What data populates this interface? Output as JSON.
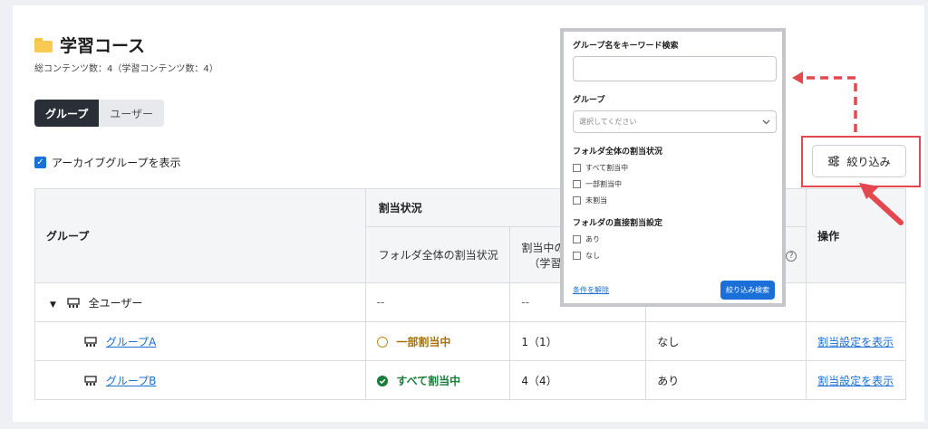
{
  "header": {
    "title": "学習コース",
    "summary": "総コンテンツ数：4（学習コンテンツ数：4）"
  },
  "tabs": [
    {
      "label": "グループ",
      "active": true
    },
    {
      "label": "ユーザー",
      "active": false
    }
  ],
  "archive_toggle": {
    "label": "アーカイブグループを表示",
    "checked": true
  },
  "filter_button": {
    "label": "絞り込み",
    "icon": "sliders-icon"
  },
  "table": {
    "col_group": "グループ",
    "col_status": "割当状況",
    "col_folder_status": "フォルダ全体の割当状況",
    "col_assigned_count": "割当中の",
    "col_assigned_sub": "（学習コ",
    "col_actions": "操作",
    "rows": [
      {
        "name": "全ユーザー",
        "folder_status": "--",
        "count": "--",
        "direct": "",
        "action": ""
      },
      {
        "name": "グループA",
        "folder_status": "一部割当中",
        "count": "1（1）",
        "direct": "なし",
        "action": "割当設定を表示"
      },
      {
        "name": "グループB",
        "folder_status": "すべて割当中",
        "count": "4（4）",
        "direct": "あり",
        "action": "割当設定を表示"
      }
    ]
  },
  "filter_panel": {
    "keyword_label": "グループ名をキーワード検索",
    "keyword_value": "",
    "group_label": "グループ",
    "group_placeholder": "選択してください",
    "folder_status_label": "フォルダ全体の割当状況",
    "folder_status_options": [
      "すべて割当中",
      "一部割当中",
      "未割当"
    ],
    "direct_label": "フォルダの直接割当設定",
    "direct_options": [
      "あり",
      "なし"
    ],
    "clear_label": "条件を解除",
    "search_label": "絞り込み検索"
  },
  "colors": {
    "accent": "#1b6fd8",
    "annotation": "#e34850",
    "partial": "#a87105",
    "all": "#1a7d3a"
  }
}
